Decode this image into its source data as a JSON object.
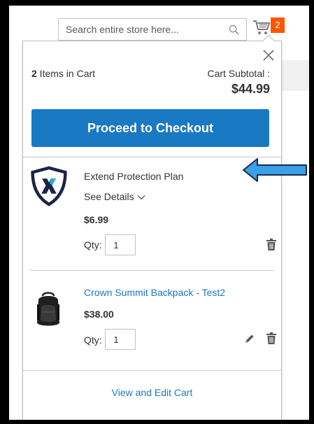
{
  "header": {
    "search_placeholder": "Search entire store here...",
    "cart_count": "2"
  },
  "minicart": {
    "items_count": "2",
    "items_label": " Items in Cart",
    "subtotal_label": "Cart Subtotal :",
    "subtotal_amount": "$44.99",
    "checkout_label": "Proceed to Checkout",
    "view_edit_label": "View and Edit Cart",
    "items": [
      {
        "name": "Extend Protection Plan",
        "details_label": "See Details",
        "price": "$6.99",
        "qty_label": "Qty:",
        "qty": "1"
      },
      {
        "name": "Crown Summit Backpack - Test2",
        "price": "$38.00",
        "qty_label": "Qty:",
        "qty": "1"
      }
    ]
  },
  "colors": {
    "accent_blue": "#1979c3",
    "counter_orange": "#ff5501",
    "annotation_arrow": "#3aa0e8"
  },
  "icons": {
    "search": "search-icon",
    "cart": "cart-icon",
    "close": "close-icon",
    "chevron": "chevron-down-icon",
    "trash": "trash-icon",
    "edit": "pencil-icon"
  }
}
